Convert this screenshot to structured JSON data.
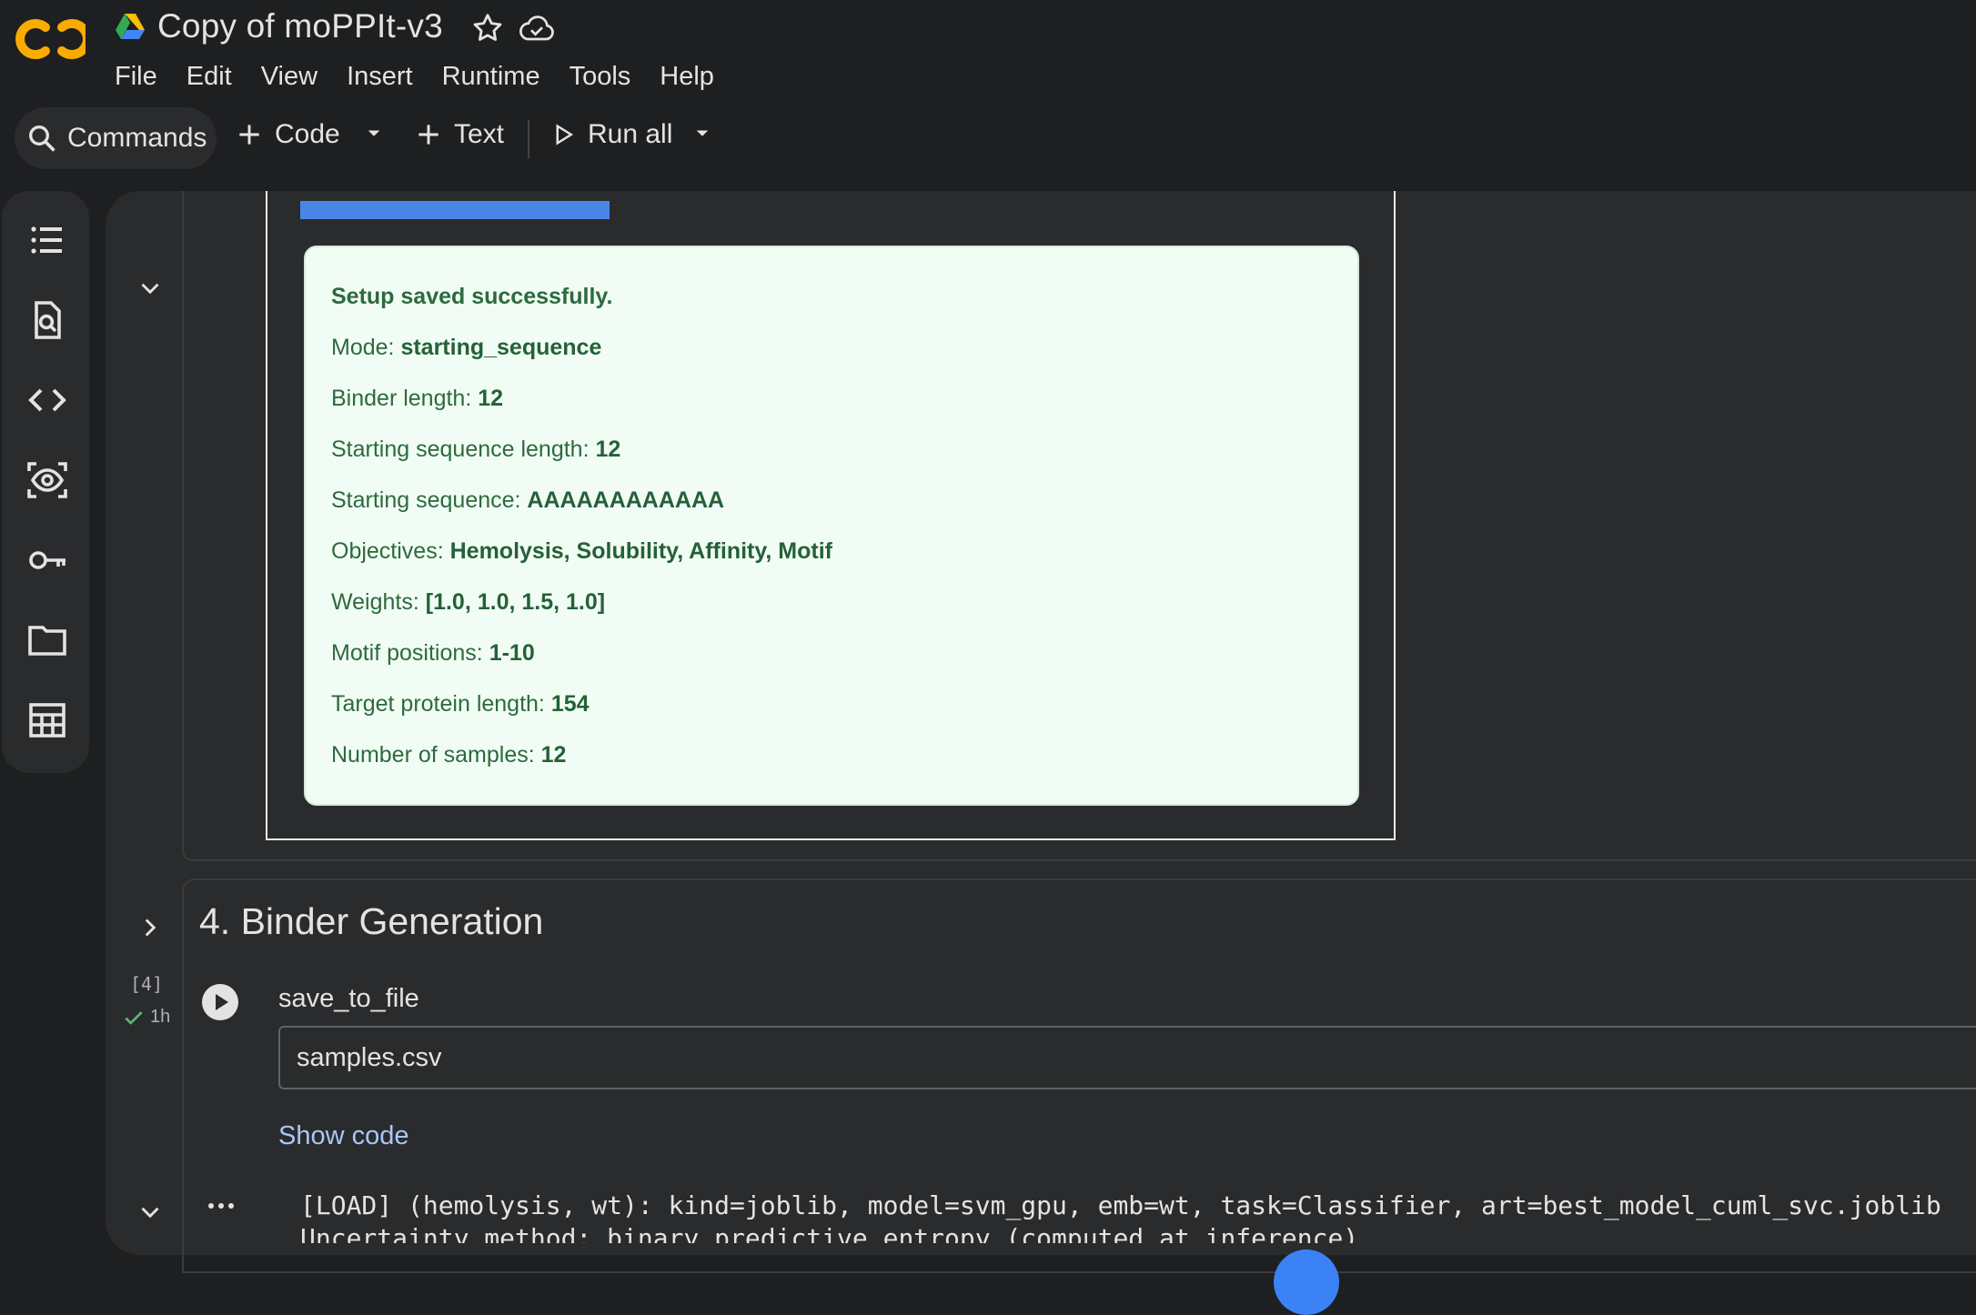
{
  "header": {
    "title": "Copy of moPPIt-v3",
    "logo_icon": "colab-logo-icon",
    "menus": [
      "File",
      "Edit",
      "View",
      "Insert",
      "Runtime",
      "Tools",
      "Help"
    ]
  },
  "toolbar": {
    "commands_label": "Commands",
    "code_label": "Code",
    "text_label": "Text",
    "run_all_label": "Run all"
  },
  "left_rail": {
    "icons": [
      "table-of-contents-icon",
      "find-replace-icon",
      "code-snippets-icon",
      "variable-inspector-icon",
      "secrets-key-icon",
      "files-folder-icon",
      "data-table-icon"
    ]
  },
  "setup_output": {
    "heading": "Setup saved successfully.",
    "rows": [
      {
        "label": "Mode: ",
        "value": "starting_sequence"
      },
      {
        "label": "Binder length: ",
        "value": "12"
      },
      {
        "label": "Starting sequence length: ",
        "value": "12"
      },
      {
        "label": "Starting sequence: ",
        "value": "AAAAAAAAAAAA"
      },
      {
        "label": "Objectives: ",
        "value": "Hemolysis, Solubility, Affinity, Motif"
      },
      {
        "label": "Weights: ",
        "value": "[1.0, 1.0, 1.5, 1.0]"
      },
      {
        "label": "Motif positions: ",
        "value": "1-10"
      },
      {
        "label": "Target protein length: ",
        "value": "154"
      },
      {
        "label": "Number of samples: ",
        "value": "12"
      }
    ],
    "progress_color": "#4a86e8"
  },
  "binder_cell": {
    "section_title": "4. Binder Generation",
    "execution_count": "[4]",
    "exec_time": "1h",
    "param_label": "save_to_file",
    "param_value": "samples.csv",
    "show_code_label": "Show code",
    "output_line1": "[LOAD] (hemolysis, wt): kind=joblib, model=svm_gpu, emb=wt, task=Classifier, art=best_model_cuml_svc.joblib",
    "output_line2": "Uncertainty method: binary predictive entropy (computed at inference)"
  },
  "colors": {
    "background": "#1e1f20",
    "panel": "#2a2b2c",
    "success_text": "#2d6a3e",
    "success_bg": "#f1fdf4",
    "link": "#a8c7fa"
  }
}
